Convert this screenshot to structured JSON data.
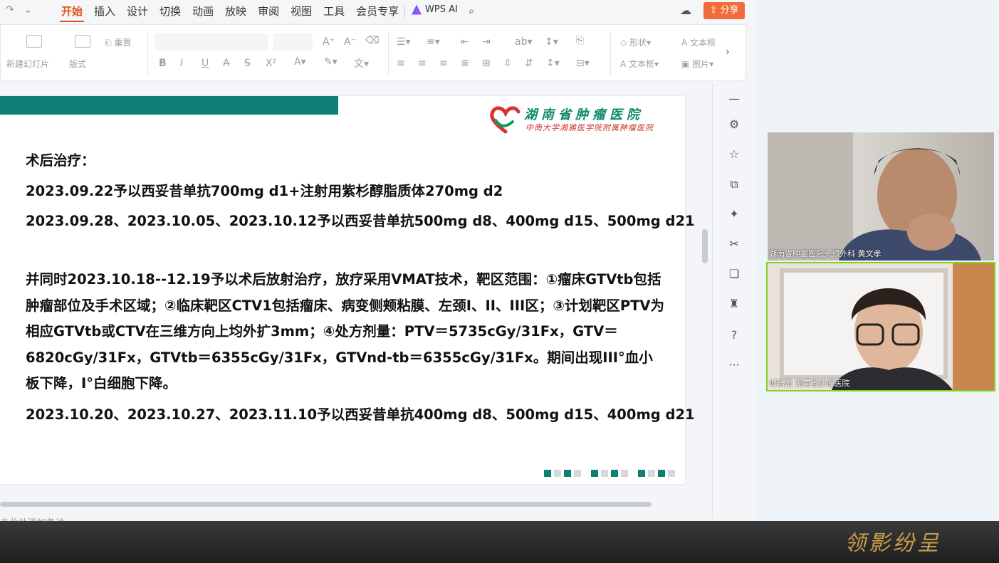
{
  "menubar": {
    "tabs": [
      "开始",
      "插入",
      "设计",
      "切换",
      "动画",
      "放映",
      "审阅",
      "视图",
      "工具",
      "会员专享"
    ],
    "active_tab": "开始",
    "wps_ai": "WPS AI",
    "share": "分享"
  },
  "ribbon": {
    "new_slide": "新建幻灯片",
    "layout": "版式",
    "reset": "重置",
    "shape": "形状",
    "textbox": "文本框",
    "textbox2": "文本框",
    "picture": "图片",
    "bold": "B",
    "italic": "I",
    "underline": "U",
    "strike": "S",
    "superscript": "X²"
  },
  "slide": {
    "hospital_name": "湖南省肿瘤医院",
    "hospital_sub": "中南大学湘雅医学院附属肿瘤医院",
    "heading": "术后治疗：",
    "line1": "2023.09.22予以西妥昔单抗700mg d1+注射用紫杉醇脂质体270mg d2",
    "line2": "2023.09.28、2023.10.05、2023.10.12予以西妥昔单抗500mg d8、400mg d15、500mg d21",
    "para": "并同时2023.10.18--12.19予以术后放射治疗，放疗采用VMAT技术，靶区范围：①瘤床GTVtb包括肿瘤部位及手术区域；②临床靶区CTV1包括瘤床、病变侧颊粘膜、左颈I、II、III区；③计划靶区PTV为相应GTVtb或CTV在三维方向上均外扩3mm；④处方剂量：PTV＝5735cGy/31Fx，GTV＝6820cGy/31Fx，GTVtb＝6355cGy/31Fx，GTVnd-tb＝6355cGy/31Fx。期间出现III°血小板下降，I°白细胞下降。",
    "line3": "2023.10.20、2023.10.27、2023.11.10予以西妥昔单抗400mg d8、500mg d15、400mg d21",
    "teal_color": "#0e7f75"
  },
  "note_text": "击此处添加备注",
  "video": {
    "tile1_label": "湖南省肿瘤医院头颈外科 黄文孝",
    "tile2_label": "谭浩蕾 湖南省肿瘤医院"
  },
  "watermark": "领影纷呈"
}
